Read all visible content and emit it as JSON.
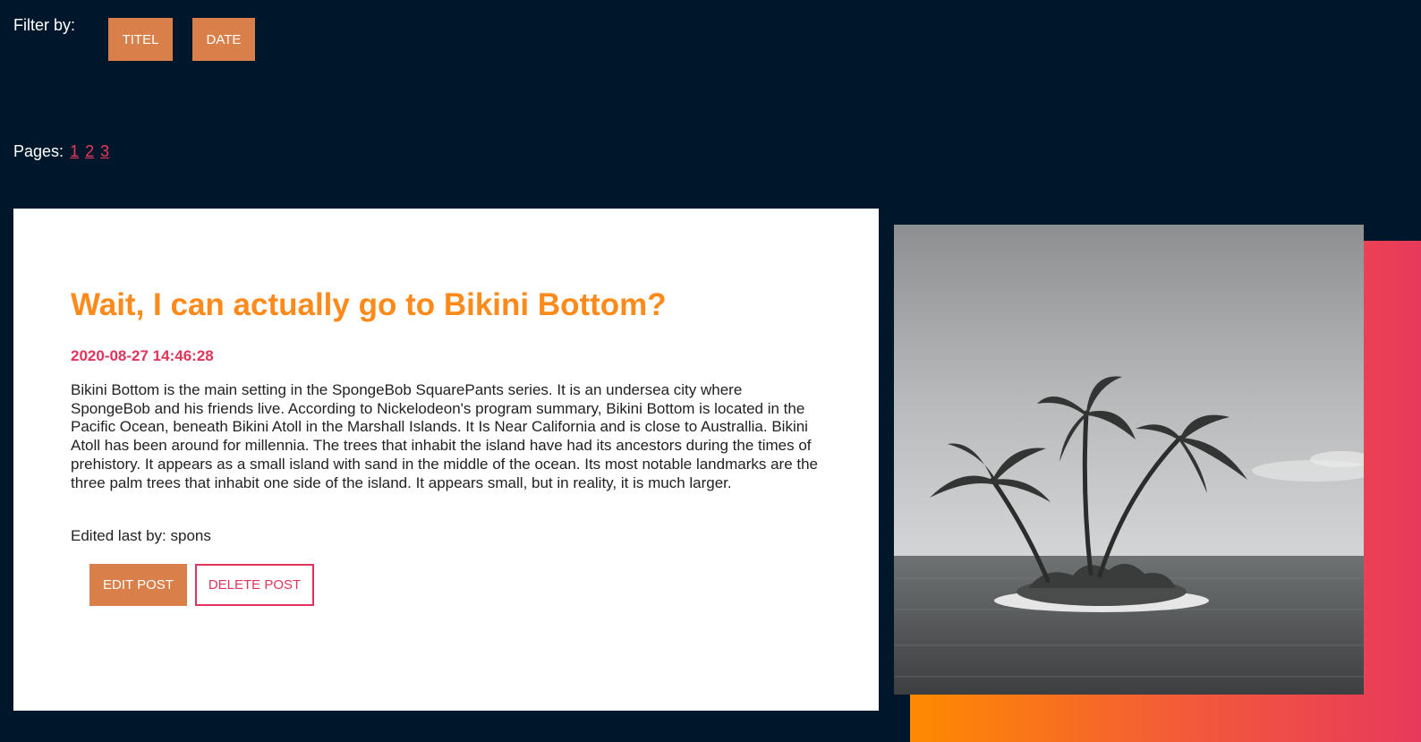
{
  "filter": {
    "label": "Filter by:",
    "buttons": [
      "TITEL",
      "DATE"
    ]
  },
  "pagination": {
    "label": "Pages:",
    "pages": [
      "1",
      "2",
      "3"
    ]
  },
  "post": {
    "title": "Wait, I can actually go to Bikini Bottom?",
    "date": "2020-08-27 14:46:28",
    "body": "Bikini Bottom is the main setting in the SpongeBob SquarePants series. It is an undersea city where SpongeBob and his friends live. According to Nickelodeon's program summary, Bikini Bottom is located in the Pacific Ocean, beneath Bikini Atoll in the Marshall Islands. It Is Near California and is close to Australlia. Bikini Atoll has been around for millennia. The trees that inhabit the island have had its ancestors during the times of prehistory. It appears as a small island with sand in the middle of the ocean. Its most notable landmarks are the three palm trees that inhabit one side of the island. It appears small, but in reality, it is much larger.",
    "edited_by": "Edited last by: spons",
    "edit_label": "EDIT POST",
    "delete_label": "DELETE POST"
  },
  "colors": {
    "background": "#00172b",
    "accent_orange": "#d9804a",
    "title_orange": "#ff8a1c",
    "accent_pink": "#e0345b"
  }
}
